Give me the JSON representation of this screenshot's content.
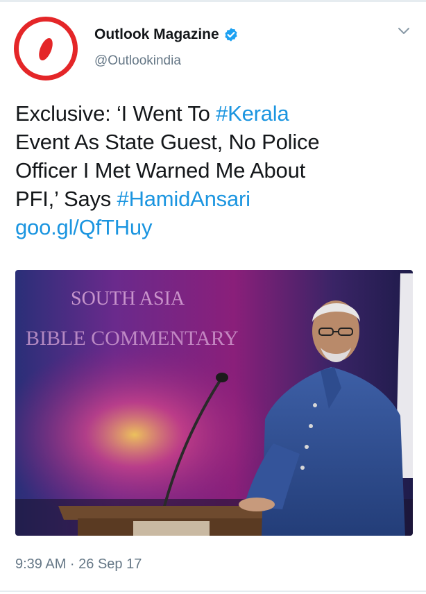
{
  "account": {
    "name": "Outlook Magazine",
    "handle": "@Outlookindia",
    "verified": true,
    "brand_color": "#e42628",
    "verified_color": "#1da1f2"
  },
  "tweet": {
    "text_lines": [
      [
        "Exclusive: ‘I Went To ",
        "#Kerala"
      ],
      [
        "Event As State Guest, No Police"
      ],
      [
        "Officer I Met Warned Me About"
      ],
      [
        "PFI,’ Says ",
        "#HamidAnsari"
      ],
      [
        "goo.gl/QfTHuy"
      ]
    ],
    "link_color": "#1b95e0"
  },
  "media": {
    "backdrop_text_line1": "SOUTH ASIA",
    "backdrop_text_line2": "BIBLE COMMENTARY"
  },
  "meta": {
    "timestamp": "9:39 AM · 26 Sep 17"
  },
  "icons": {
    "avatar": "outlook-logo-icon",
    "verified": "verified-badge-icon",
    "menu": "chevron-down-icon"
  }
}
